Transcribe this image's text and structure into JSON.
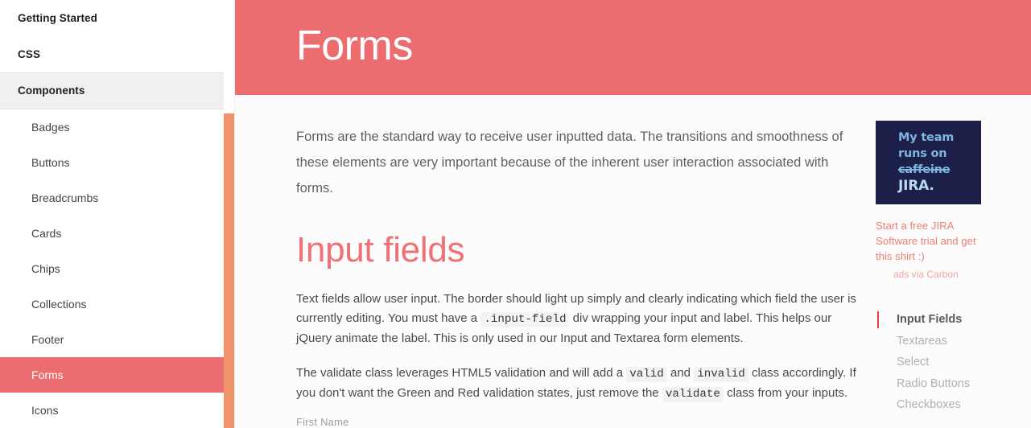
{
  "sidebar": {
    "groups": [
      {
        "label": "Getting Started",
        "shaded": false
      },
      {
        "label": "CSS",
        "shaded": false
      },
      {
        "label": "Components",
        "shaded": true
      }
    ],
    "items": [
      {
        "label": "Badges",
        "active": false
      },
      {
        "label": "Buttons",
        "active": false
      },
      {
        "label": "Breadcrumbs",
        "active": false
      },
      {
        "label": "Cards",
        "active": false
      },
      {
        "label": "Chips",
        "active": false
      },
      {
        "label": "Collections",
        "active": false
      },
      {
        "label": "Footer",
        "active": false
      },
      {
        "label": "Forms",
        "active": true
      },
      {
        "label": "Icons",
        "active": false
      }
    ],
    "scrollbar": {
      "thumb_color": "#f0936a"
    }
  },
  "header": {
    "title": "Forms",
    "background_color": "#ec6d70",
    "text_color": "#ffffff"
  },
  "main": {
    "lede": "Forms are the standard way to receive user inputted data. The transitions and smoothness of these elements are very important because of the inherent user interaction associated with forms.",
    "section_heading": "Input fields",
    "section_heading_color": "#ef7176",
    "paragraph_1": {
      "part_1": "Text fields allow user input. The border should light up simply and clearly indicating which field the user is currently editing. You must have a",
      "code_1": ".input-field",
      "part_2": "div wrapping your input and label. This helps our jQuery animate the label. This is only used in our Input and Textarea form elements."
    },
    "paragraph_2": {
      "part_1": "The validate class leverages HTML5 validation and will add a",
      "code_1": "valid",
      "part_2": "and",
      "code_2": "invalid",
      "part_3": "class accordingly. If you don't want the Green and Red validation states, just remove the",
      "code_3": "validate",
      "part_4": "class from your inputs."
    },
    "first_field_label": "First Name"
  },
  "ad": {
    "image_line_1": "My team",
    "image_line_2": "runs on",
    "image_line_3": "caffeine",
    "image_line_4": "JIRA.",
    "image_bg_color": "#1c2048",
    "copy": "Start a free JIRA Software trial and get this shirt :)",
    "via": "ads via Carbon"
  },
  "toc": {
    "items": [
      {
        "label": "Input Fields",
        "active": true
      },
      {
        "label": "Textareas",
        "active": false
      },
      {
        "label": "Select",
        "active": false
      },
      {
        "label": "Radio Buttons",
        "active": false
      },
      {
        "label": "Checkboxes",
        "active": false
      }
    ],
    "active_marker_color": "#ee3b3b"
  }
}
